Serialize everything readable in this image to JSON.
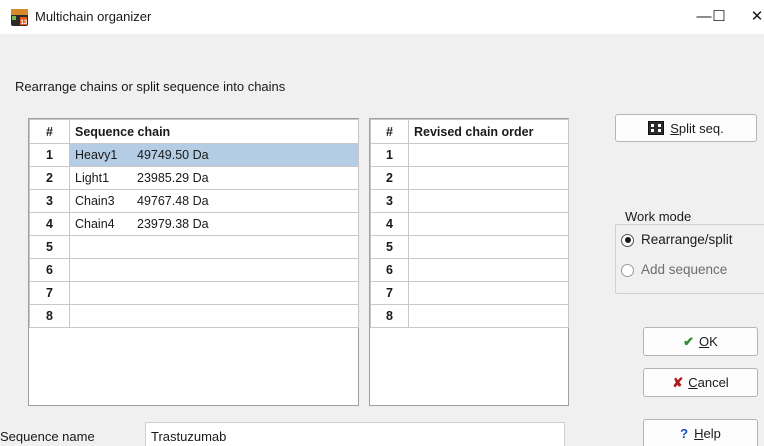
{
  "window": {
    "title": "Multichain organizer",
    "minimize_glyph": "—",
    "maximize_glyph": "☐",
    "close_glyph": "✕"
  },
  "instruction": "Rearrange chains or split sequence into chains",
  "left_table": {
    "headers": [
      "#",
      "Sequence chain"
    ],
    "rows": [
      {
        "num": "1",
        "name": "Heavy1",
        "mass": "49749.50 Da",
        "selected": true
      },
      {
        "num": "2",
        "name": "Light1",
        "mass": "23985.29 Da"
      },
      {
        "num": "3",
        "name": "Chain3",
        "mass": "49767.48 Da"
      },
      {
        "num": "4",
        "name": "Chain4",
        "mass": "23979.38 Da"
      },
      {
        "num": "5",
        "name": "",
        "mass": ""
      },
      {
        "num": "6",
        "name": "",
        "mass": ""
      },
      {
        "num": "7",
        "name": "",
        "mass": ""
      },
      {
        "num": "8",
        "name": "",
        "mass": ""
      }
    ]
  },
  "right_table": {
    "headers": [
      "#",
      "Revised chain order"
    ],
    "rows": [
      {
        "num": "1",
        "value": ""
      },
      {
        "num": "2",
        "value": ""
      },
      {
        "num": "3",
        "value": ""
      },
      {
        "num": "4",
        "value": ""
      },
      {
        "num": "5",
        "value": ""
      },
      {
        "num": "6",
        "value": ""
      },
      {
        "num": "7",
        "value": ""
      },
      {
        "num": "8",
        "value": ""
      }
    ]
  },
  "buttons": {
    "split": {
      "mnemonic": "S",
      "rest": "plit seq.",
      "icon": "split-icon"
    },
    "ok": {
      "mnemonic": "O",
      "rest": "K",
      "icon": "checkmark-icon"
    },
    "cancel": {
      "mnemonic": "C",
      "rest": "ancel",
      "icon": "cross-icon"
    },
    "help": {
      "mnemonic": "H",
      "rest": "elp",
      "icon": "question-icon"
    }
  },
  "work_mode": {
    "legend": "Work mode",
    "options": [
      {
        "label": "Rearrange/split",
        "selected": true,
        "enabled": true
      },
      {
        "label": "Add sequence",
        "selected": false,
        "enabled": false
      }
    ]
  },
  "sequence_name": {
    "label": "Sequence name",
    "value": "Trastuzumab"
  },
  "colors": {
    "selection": "#b5cde4",
    "ok_check": "#2e8b2e",
    "cancel_cross": "#b11a1a",
    "help_mark": "#1f4fbf"
  }
}
